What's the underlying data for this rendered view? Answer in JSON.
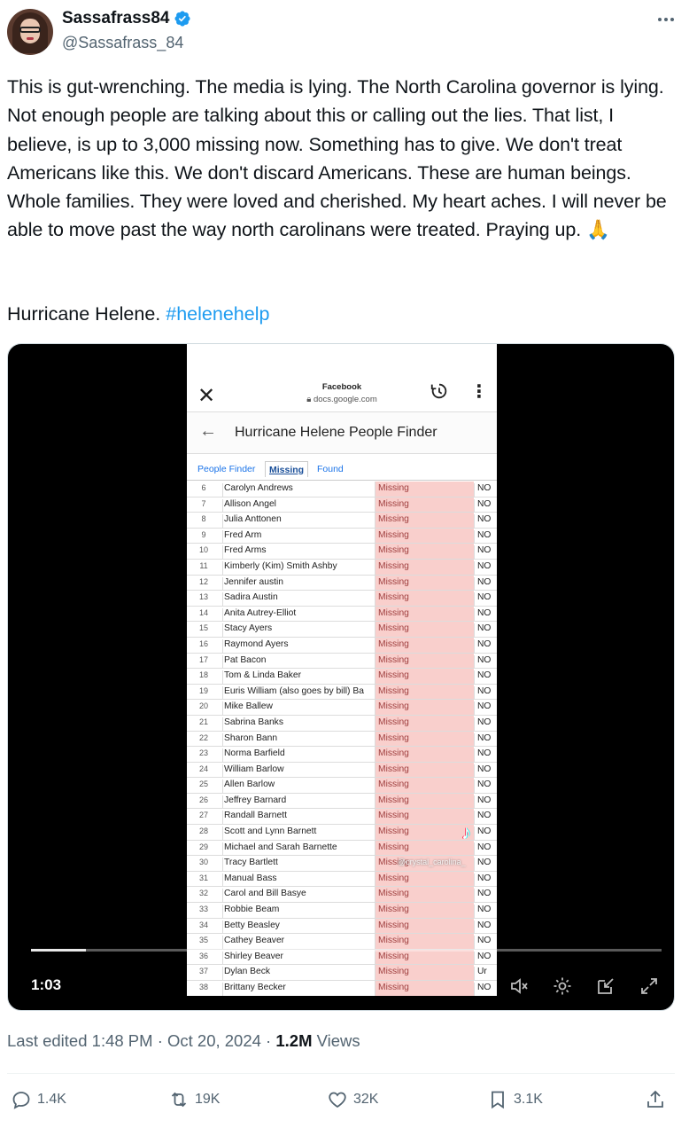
{
  "user": {
    "display_name": "Sassafrass84",
    "handle": "@Sassafrass_84"
  },
  "tweet": {
    "text": "This is gut-wrenching. The media is lying. The North Carolina governor is lying. Not enough people are talking about this or calling out the lies. That list, I believe, is up to 3,000 missing now. Something has to give. We don't treat Americans like this. We don't discard Americans. These are human beings. Whole families. They were loved and cherished. My heart aches. I will never be able to move past the way north carolinans were treated. Praying up. 🙏",
    "tag_prefix": "Hurricane Helene.",
    "hashtag": "#helenehelp"
  },
  "video": {
    "time": "1:03",
    "phone": {
      "site_name": "Facebook",
      "url": "docs.google.com",
      "sheet_title": "Hurricane Helene People Finder",
      "tabs": [
        "People Finder",
        "Missing",
        "Found"
      ],
      "active_tab": "Missing",
      "watermark": "TikTok",
      "watermark_user": "@crystal_carolina_"
    },
    "rows": [
      {
        "n": "6",
        "name": "Carolyn Andrews",
        "status": "Missing",
        "x": "NO"
      },
      {
        "n": "7",
        "name": "Allison Angel",
        "status": "Missing",
        "x": "NO"
      },
      {
        "n": "8",
        "name": "Julia Anttonen",
        "status": "Missing",
        "x": "NO"
      },
      {
        "n": "9",
        "name": "Fred Arm",
        "status": "Missing",
        "x": "NO"
      },
      {
        "n": "10",
        "name": "Fred Arms",
        "status": "Missing",
        "x": "NO"
      },
      {
        "n": "11",
        "name": "Kimberly (Kim) Smith Ashby",
        "status": "Missing",
        "x": "NO"
      },
      {
        "n": "12",
        "name": "Jennifer austin",
        "status": "Missing",
        "x": "NO"
      },
      {
        "n": "13",
        "name": "Sadira Austin",
        "status": "Missing",
        "x": "NO"
      },
      {
        "n": "14",
        "name": "Anita Autrey-Elliot",
        "status": "Missing",
        "x": "NO"
      },
      {
        "n": "15",
        "name": "Stacy Ayers",
        "status": "Missing",
        "x": "NO"
      },
      {
        "n": "16",
        "name": "Raymond Ayers",
        "status": "Missing",
        "x": "NO"
      },
      {
        "n": "17",
        "name": "Pat Bacon",
        "status": "Missing",
        "x": "NO"
      },
      {
        "n": "18",
        "name": "Tom & Linda Baker",
        "status": "Missing",
        "x": "NO"
      },
      {
        "n": "19",
        "name": "Euris William (also goes by bill) Ba",
        "status": "Missing",
        "x": "NO"
      },
      {
        "n": "20",
        "name": "Mike Ballew",
        "status": "Missing",
        "x": "NO"
      },
      {
        "n": "21",
        "name": "Sabrina Banks",
        "status": "Missing",
        "x": "NO"
      },
      {
        "n": "22",
        "name": "Sharon Bann",
        "status": "Missing",
        "x": "NO"
      },
      {
        "n": "23",
        "name": "Norma Barfield",
        "status": "Missing",
        "x": "NO"
      },
      {
        "n": "24",
        "name": "William Barlow",
        "status": "Missing",
        "x": "NO"
      },
      {
        "n": "25",
        "name": "Allen Barlow",
        "status": "Missing",
        "x": "NO"
      },
      {
        "n": "26",
        "name": "Jeffrey Barnard",
        "status": "Missing",
        "x": "NO"
      },
      {
        "n": "27",
        "name": "Randall Barnett",
        "status": "Missing",
        "x": "NO"
      },
      {
        "n": "28",
        "name": "Scott and Lynn Barnett",
        "status": "Missing",
        "x": "NO"
      },
      {
        "n": "29",
        "name": "Michael and Sarah Barnette",
        "status": "Missing",
        "x": "NO"
      },
      {
        "n": "30",
        "name": "Tracy Bartlett",
        "status": "Missing",
        "x": "NO"
      },
      {
        "n": "31",
        "name": "Manual Bass",
        "status": "Missing",
        "x": "NO"
      },
      {
        "n": "32",
        "name": "Carol and Bill Basye",
        "status": "Missing",
        "x": "NO"
      },
      {
        "n": "33",
        "name": "Robbie Beam",
        "status": "Missing",
        "x": "NO"
      },
      {
        "n": "34",
        "name": "Betty Beasley",
        "status": "Missing",
        "x": "NO"
      },
      {
        "n": "35",
        "name": "Cathey Beaver",
        "status": "Missing",
        "x": "NO"
      },
      {
        "n": "36",
        "name": "Shirley Beaver",
        "status": "Missing",
        "x": "NO"
      },
      {
        "n": "37",
        "name": "Dylan Beck",
        "status": "Missing",
        "x": "Ur"
      },
      {
        "n": "38",
        "name": "Brittany Becker",
        "status": "Missing",
        "x": "NO"
      }
    ]
  },
  "meta": {
    "edited": "Last edited 1:48 PM · Oct 20, 2024 · ",
    "views_count": "1.2M",
    "views_label": " Views"
  },
  "actions": {
    "replies": "1.4K",
    "reposts": "19K",
    "likes": "32K",
    "bookmarks": "3.1K"
  },
  "colors": {
    "accent": "#1d9bf0",
    "text": "#0f1419",
    "secondary": "#536471",
    "missing_cell": "#f9cfcc"
  }
}
